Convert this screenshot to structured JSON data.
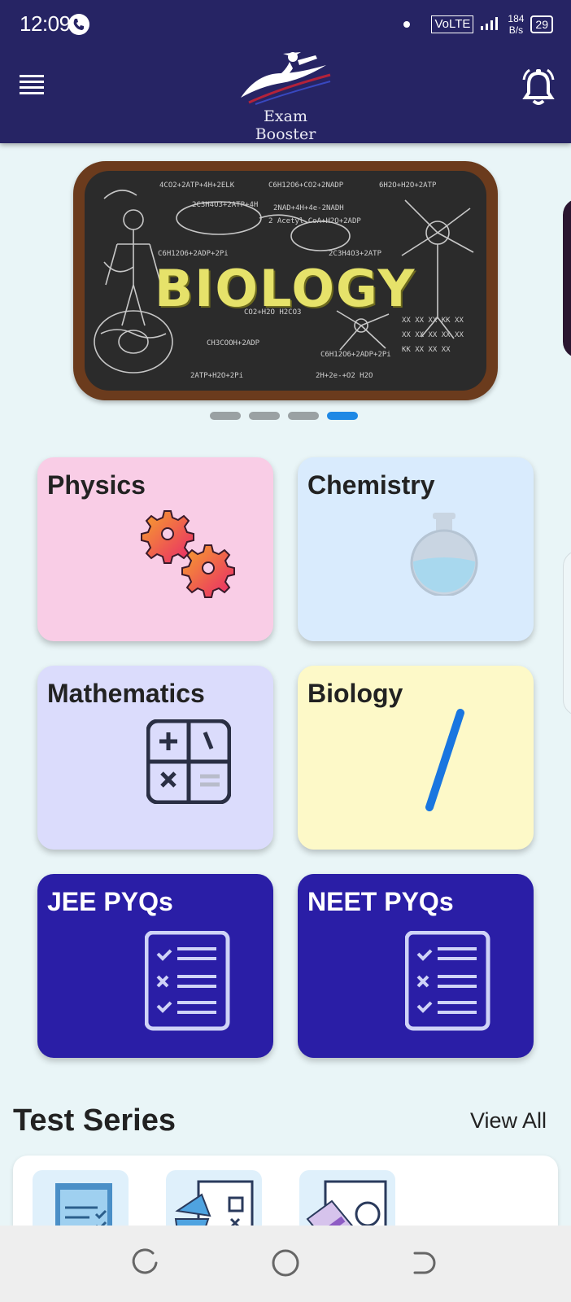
{
  "status_bar": {
    "time": "12:09",
    "network": "VoLTE",
    "speed_top": "184",
    "speed_bottom": "B/s",
    "battery": "29"
  },
  "header": {
    "app_name": "Exam Booster",
    "background_color": "#262464"
  },
  "carousel": {
    "banner_text": "BIOLOGY",
    "slide_count": 4,
    "active_slide": 4
  },
  "subjects": [
    {
      "label": "Physics",
      "color": "#f9cde6",
      "icon": "gears-icon"
    },
    {
      "label": "Chemistry",
      "color": "#d9ebfd",
      "icon": "flask-icon"
    },
    {
      "label": "Mathematics",
      "color": "#dbdcfc",
      "icon": "calculator-icon"
    },
    {
      "label": "Biology",
      "color": "#fdf9c8",
      "icon": "dna-icon"
    },
    {
      "label": "JEE PYQs",
      "color": "#2a1ea6",
      "icon": "checklist-icon"
    },
    {
      "label": "NEET PYQs",
      "color": "#2a1ea6",
      "icon": "checklist-icon"
    }
  ],
  "test_series": {
    "title": "Test Series",
    "view_all": "View All"
  }
}
